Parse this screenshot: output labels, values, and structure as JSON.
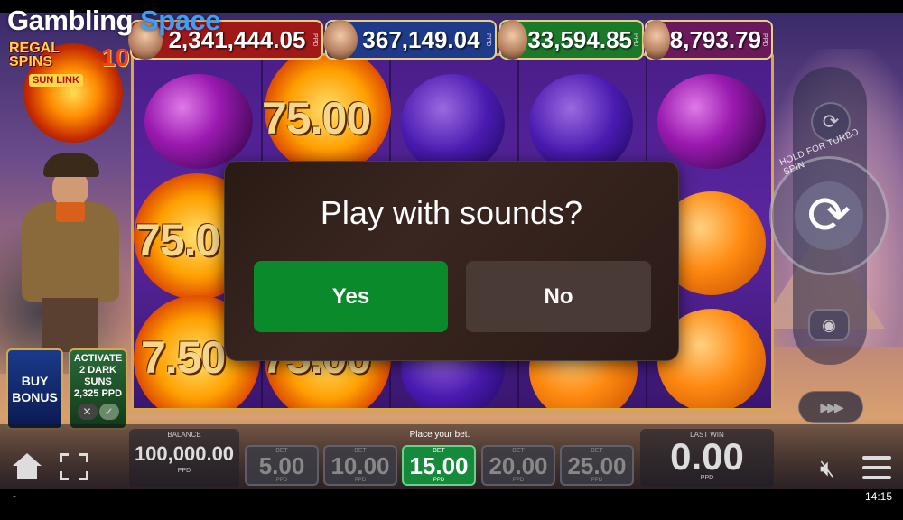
{
  "watermark": {
    "gambling": "Gambling",
    "space": "Space"
  },
  "logo": {
    "title_line1": "REGAL",
    "title_line2": "SPINS",
    "number": "10",
    "sublink": "SUN LINK"
  },
  "jackpots": [
    {
      "amount": "2,341,444.05",
      "unit": "PPD",
      "color": "#a01818"
    },
    {
      "amount": "367,149.04",
      "unit": "PPD",
      "color": "#1e3a8a"
    },
    {
      "amount": "33,594.85",
      "unit": "PPD",
      "color": "#1a7a2a"
    },
    {
      "amount": "8,793.79",
      "unit": "PPD",
      "color": "#6a1a5a"
    }
  ],
  "reel_values": [
    "75.00",
    "75.0",
    "7.50",
    "75.00"
  ],
  "buy_bonus": {
    "line1": "BUY",
    "line2": "BONUS"
  },
  "activate": {
    "line1": "ACTIVATE",
    "line2": "2 DARK",
    "line3": "SUNS",
    "line4": "2,325 PPD",
    "off": "✕",
    "on": "✓"
  },
  "turbo_label": "HOLD FOR TURBO SPIN",
  "balance": {
    "label": "BALANCE",
    "value": "100,000.00",
    "unit": "PPD"
  },
  "place_bet_label": "Place your bet.",
  "bets": [
    {
      "label": "BET",
      "value": "5.00",
      "unit": "PPD",
      "active": false
    },
    {
      "label": "BET",
      "value": "10.00",
      "unit": "PPD",
      "active": false
    },
    {
      "label": "BET",
      "value": "15.00",
      "unit": "PPD",
      "active": true
    },
    {
      "label": "BET",
      "value": "20.00",
      "unit": "PPD",
      "active": false
    },
    {
      "label": "BET",
      "value": "25.00",
      "unit": "PPD",
      "active": false
    }
  ],
  "last_win": {
    "label": "LAST WIN",
    "value": "0.00",
    "unit": "PPD"
  },
  "dialog": {
    "question": "Play with sounds?",
    "yes": "Yes",
    "no": "No"
  },
  "status": {
    "left": "-",
    "time": "14:15"
  },
  "colors": {
    "accent_green": "#0a8a2a",
    "reel_frame": "#d6a84a"
  }
}
